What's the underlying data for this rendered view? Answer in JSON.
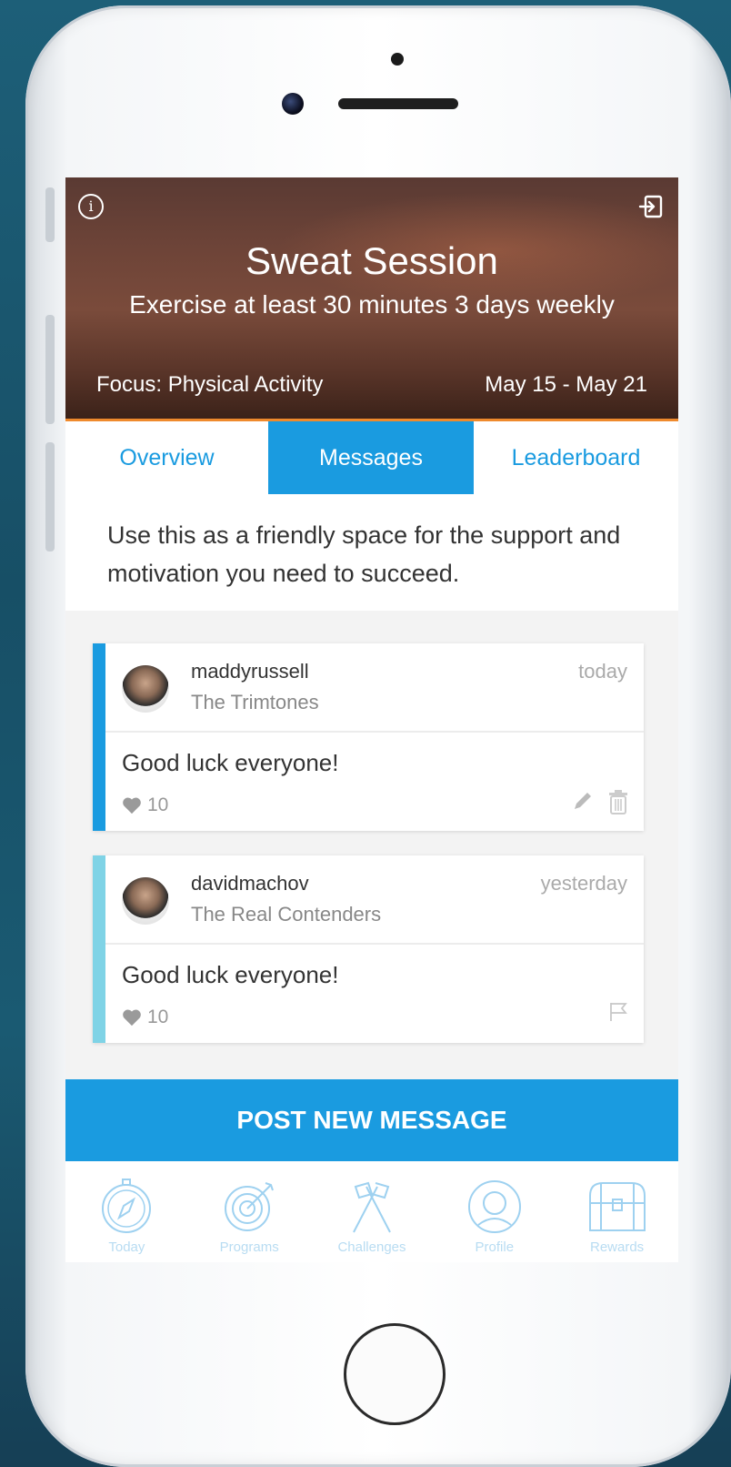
{
  "header": {
    "title": "Sweat Session",
    "subtitle": "Exercise at least 30 minutes 3 days weekly",
    "focus": "Focus: Physical Activity",
    "dates": "May 15 - May 21",
    "info_icon": "info-icon",
    "exit_icon": "exit-icon"
  },
  "tabs": [
    {
      "label": "Overview",
      "active": false
    },
    {
      "label": "Messages",
      "active": true
    },
    {
      "label": "Leaderboard",
      "active": false
    }
  ],
  "intro": "Use this as a friendly space for the support and motivation you need to succeed.",
  "messages": [
    {
      "username": "maddyrussell",
      "team": "The Trimtones",
      "time": "today",
      "text": "Good luck everyone!",
      "likes": "10",
      "accent": "#1a9be0",
      "actions": [
        "edit-icon",
        "trash-icon"
      ]
    },
    {
      "username": "davidmachov",
      "team": "The Real Contenders",
      "time": "yesterday",
      "text": "Good luck everyone!",
      "likes": "10",
      "accent": "#7fd3e6",
      "actions": [
        "flag-icon"
      ]
    }
  ],
  "post_button": "POST NEW MESSAGE",
  "nav": [
    {
      "label": "Today",
      "icon": "compass-icon"
    },
    {
      "label": "Programs",
      "icon": "target-icon"
    },
    {
      "label": "Challenges",
      "icon": "flags-icon"
    },
    {
      "label": "Profile",
      "icon": "profile-icon"
    },
    {
      "label": "Rewards",
      "icon": "treasure-chest-icon"
    }
  ],
  "colors": {
    "accent": "#1a9be0",
    "header_border": "#ef8a2d",
    "nav_icon": "#b8dcf2"
  }
}
